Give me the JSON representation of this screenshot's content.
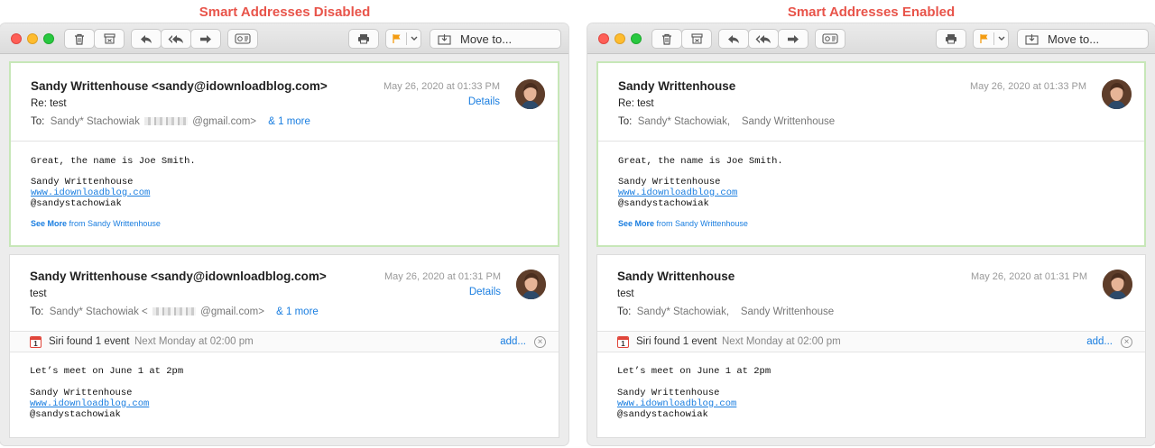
{
  "panels": [
    {
      "title": "Smart Addresses Disabled",
      "toolbar": {
        "move_to": "Move to..."
      },
      "messages": [
        {
          "sender": "Sandy Writtenhouse <sandy@idownloadblog.com>",
          "date": "May 26, 2020 at 01:33 PM",
          "details": "Details",
          "subject": "Re: test",
          "to_label": "To:",
          "to_name": "Sandy* Stachowiak",
          "to_address": "@gmail.com>",
          "more": "& 1 more",
          "body_line": "Great, the name is Joe Smith.",
          "sig_name": "Sandy Writtenhouse",
          "sig_link": "www.idownloadblog.com",
          "sig_handle": "@sandystachowiak",
          "see_more": "See More",
          "see_more_from": "from Sandy Writtenhouse"
        },
        {
          "sender": "Sandy Writtenhouse <sandy@idownloadblog.com>",
          "date": "May 26, 2020 at 01:31 PM",
          "details": "Details",
          "subject": "test",
          "to_label": "To:",
          "to_name": "Sandy* Stachowiak <",
          "to_address": "@gmail.com>",
          "more": "& 1 more",
          "siri_text": "Siri found 1 event",
          "siri_when": "Next Monday at 02:00 pm",
          "siri_add": "add...",
          "body_line": "Let’s meet on June 1 at 2pm",
          "sig_name": "Sandy Writtenhouse",
          "sig_link": "www.idownloadblog.com",
          "sig_handle": "@sandystachowiak"
        }
      ]
    },
    {
      "title": "Smart Addresses Enabled",
      "toolbar": {
        "move_to": "Move to..."
      },
      "messages": [
        {
          "sender": "Sandy Writtenhouse",
          "date": "May 26, 2020 at 01:33 PM",
          "subject": "Re: test",
          "to_label": "To:",
          "to_name": "Sandy* Stachowiak,",
          "to_second": "Sandy Writtenhouse",
          "body_line": "Great, the name is Joe Smith.",
          "sig_name": "Sandy Writtenhouse",
          "sig_link": "www.idownloadblog.com",
          "sig_handle": "@sandystachowiak",
          "see_more": "See More",
          "see_more_from": "from Sandy Writtenhouse"
        },
        {
          "sender": "Sandy Writtenhouse",
          "date": "May 26, 2020 at 01:31 PM",
          "subject": "test",
          "to_label": "To:",
          "to_name": "Sandy* Stachowiak,",
          "to_second": "Sandy Writtenhouse",
          "siri_text": "Siri found 1 event",
          "siri_when": "Next Monday at 02:00 pm",
          "siri_add": "add...",
          "body_line": "Let’s meet on June 1 at 2pm",
          "sig_name": "Sandy Writtenhouse",
          "sig_link": "www.idownloadblog.com",
          "sig_handle": "@sandystachowiak"
        }
      ]
    }
  ],
  "calendar_icon_day": "1",
  "icons": [
    "trash-icon",
    "archive-icon",
    "reply-icon",
    "reply-all-icon",
    "forward-icon",
    "view-icon",
    "print-icon",
    "flag-icon",
    "chevron-down-icon",
    "move-to-icon",
    "close-icon",
    "calendar-icon"
  ],
  "colors": {
    "title": "#e8544a",
    "link": "#1a7ee0",
    "flag": "#f39c12",
    "selected_border": "#c7e7b8"
  }
}
